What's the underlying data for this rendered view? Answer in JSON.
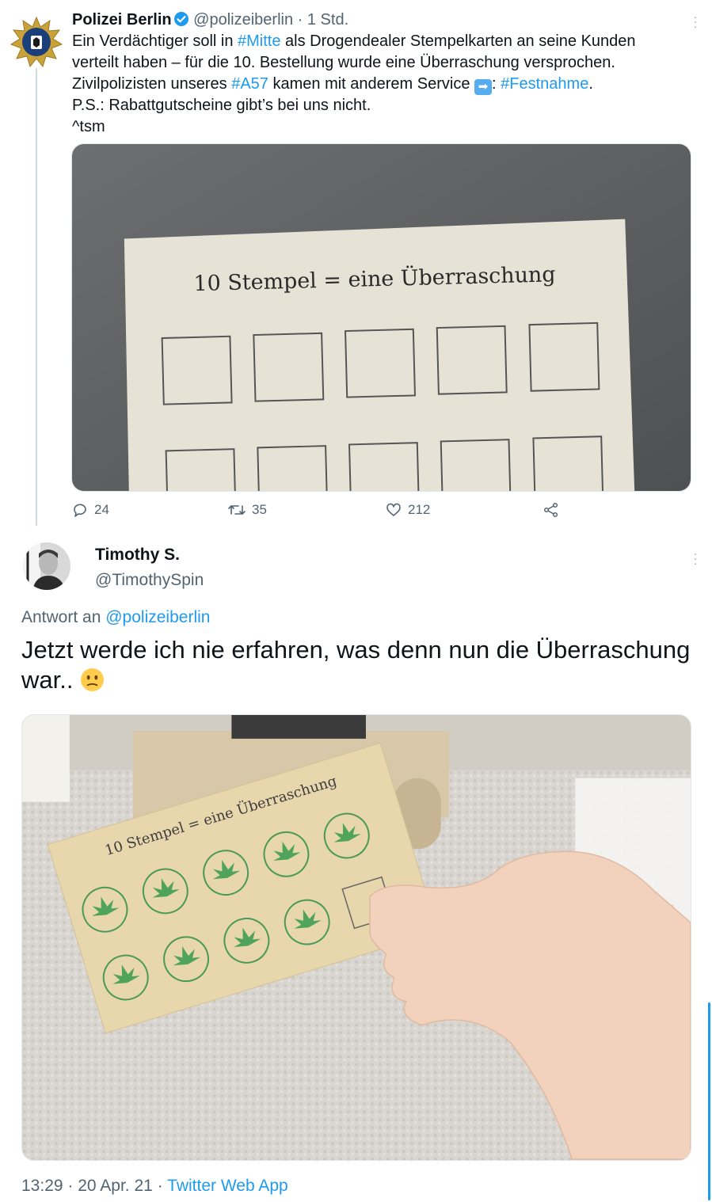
{
  "tweet": {
    "author_name": "Polizei Berlin",
    "author_handle": "@polizeiberlin",
    "separator": "·",
    "time": "1 Std.",
    "text": {
      "l1_a": "Ein Verdächtiger soll in ",
      "l1_tag": "#Mitte",
      "l1_b": " als Drogendealer Stempelkarten an seine Kunden",
      "l2": "verteilt haben – für die 10. Bestellung wurde eine Überraschung versprochen.",
      "l3_a": "Zivilpolizisten unseres ",
      "l3_tag": "#A57",
      "l3_b": " kamen mit anderem Service ",
      "l3_c": ": ",
      "l3_tag2": "#Festnahme",
      "l3_d": ".",
      "l4": "P.S.: Rabattgutscheine gibt’s bei uns nicht.",
      "l5": "^tsm"
    },
    "image_card_text": "10 Stempel = eine Überraschung",
    "actions": {
      "replies": "24",
      "retweets": "35",
      "likes": "212"
    }
  },
  "reply": {
    "author_name": "Timothy S.",
    "author_handle": "@TimothySpin",
    "reply_prefix": "Antwort an ",
    "reply_to": "@polizeiberlin",
    "text_l1": "Jetzt werde ich nie erfahren, was denn nun die Überraschung",
    "text_l2": "war.. ",
    "image_card_text": "10 Stempel = eine Überraschung",
    "time": "13:29",
    "date": "20 Apr. 21",
    "source": "Twitter Web App",
    "separator": "·"
  },
  "colors": {
    "link": "#1d9bf0",
    "muted": "#536471",
    "text": "#0f1419",
    "thread_line": "#cfd9de"
  },
  "icons": [
    "police-star-avatar",
    "verified-badge-icon",
    "more-icon",
    "reply-icon",
    "retweet-icon",
    "like-icon",
    "share-icon",
    "arrow-right-emoji",
    "confused-face-emoji"
  ]
}
